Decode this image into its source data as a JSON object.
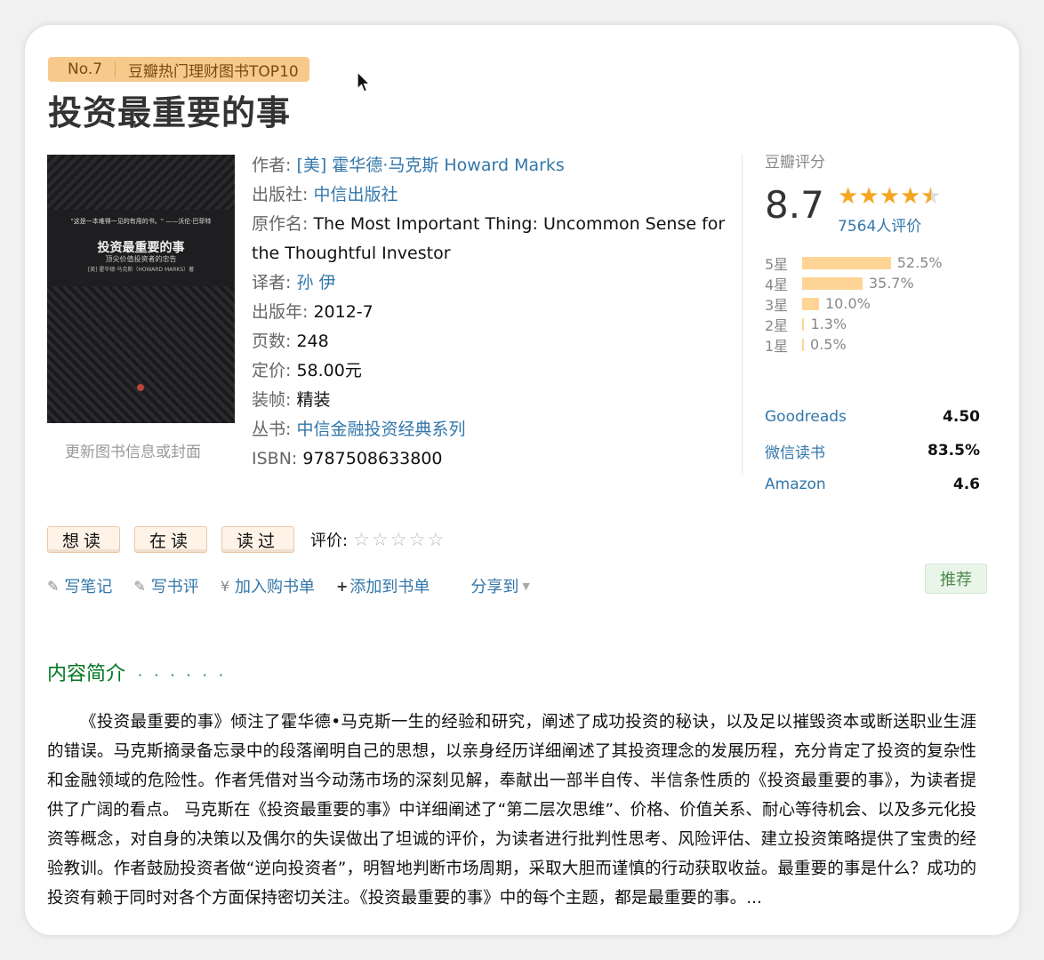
{
  "badge": {
    "rank": "No.7",
    "text": "豆瓣热门理财图书TOP10"
  },
  "book": {
    "title": "投资最重要的事",
    "cover": {
      "quote": "\"这是一本难得一见的有用的书。\" ——沃伦·巴菲特",
      "title": "投资最重要的事",
      "subtitle": "顶尖价值投资者的忠告",
      "author": "[美] 霍华德·马克斯（HOWARD MARKS）著"
    },
    "update_link": "更新图书信息或封面"
  },
  "info": {
    "author_label": "作者:",
    "author": "[美] 霍华德·马克斯 Howard Marks",
    "publisher_label": "出版社:",
    "publisher": "中信出版社",
    "original_label": "原作名:",
    "original": "The Most Important Thing: Uncommon Sense for the Thoughtful Investor",
    "translator_label": "译者:",
    "translator": "孙 伊",
    "year_label": "出版年:",
    "year": "2012-7",
    "pages_label": "页数:",
    "pages": "248",
    "price_label": "定价:",
    "price": "58.00元",
    "binding_label": "装帧:",
    "binding": "精装",
    "series_label": "丛书:",
    "series": "中信金融投资经典系列",
    "isbn_label": "ISBN:",
    "isbn": "9787508633800"
  },
  "rating": {
    "head": "豆瓣评分",
    "score": "8.7",
    "stars": 4.5,
    "count": "7564人评价",
    "distribution": [
      {
        "label": "5星",
        "percent": "52.5%",
        "value": 52.5
      },
      {
        "label": "4星",
        "percent": "35.7%",
        "value": 35.7
      },
      {
        "label": "3星",
        "percent": "10.0%",
        "value": 10.0
      },
      {
        "label": "2星",
        "percent": "1.3%",
        "value": 1.3
      },
      {
        "label": "1星",
        "percent": "0.5%",
        "value": 0.5
      }
    ],
    "other": [
      {
        "name": "Goodreads",
        "value": "4.50"
      },
      {
        "name": "微信读书",
        "value": "83.5%"
      },
      {
        "name": "Amazon",
        "value": "4.6"
      }
    ]
  },
  "actions": {
    "want": "想读",
    "reading": "在读",
    "read": "读过",
    "rate_label": "评价:"
  },
  "tools": {
    "note": "写笔记",
    "review": "写书评",
    "cart": "加入购书单",
    "add_list": "添加到书单",
    "share": "分享到",
    "recommend": "推荐"
  },
  "intro": {
    "title": "内容简介",
    "dots": "· · · · · ·",
    "text": "《投资最重要的事》倾注了霍华德•马克斯一生的经验和研究，阐述了成功投资的秘诀，以及足以摧毁资本或断送职业生涯的错误。马克斯摘录备忘录中的段落阐明自己的思想，以亲身经历详细阐述了其投资理念的发展历程，充分肯定了投资的复杂性和金融领域的危险性。作者凭借对当今动荡市场的深刻见解，奉献出一部半自传、半信条性质的《投资最重要的事》，为读者提供了广阔的看点。 马克斯在《投资最重要的事》中详细阐述了“第二层次思维”、价格、价值关系、耐心等待机会、以及多元化投资等概念，对自身的决策以及偶尔的失误做出了坦诚的评价，为读者进行批判性思考、风险评估、建立投资策略提供了宝贵的经验教训。作者鼓励投资者做“逆向投资者”，明智地判断市场周期，采取大胆而谨慎的行动获取收益。最重要的事是什么？成功的投资有赖于同时对各个方面保持密切关注。《投资最重要的事》中的每个主题，都是最重要的事。..."
  }
}
